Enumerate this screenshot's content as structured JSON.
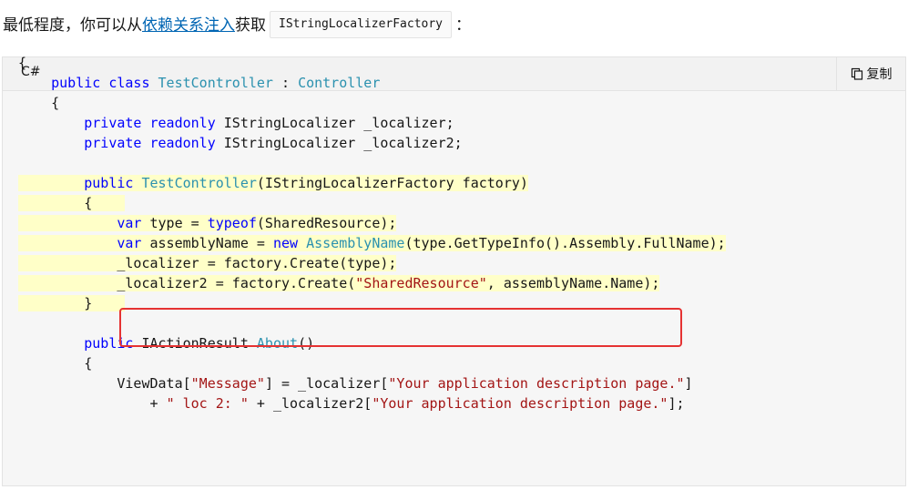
{
  "intro": {
    "before": "最低程度，你可以从",
    "link": "依赖关系注入",
    "after": "获取",
    "code": "IStringLocalizerFactory",
    "end": "："
  },
  "code_block": {
    "language": "C#",
    "copy_label": "复制",
    "copy_icon": "copy-icon",
    "highlight_color": "#ffffc8",
    "annotation_color": "#e53232",
    "lines": [
      "{",
      "    public class TestController : Controller",
      "    {",
      "        private readonly IStringLocalizer _localizer;",
      "        private readonly IStringLocalizer _localizer2;",
      "",
      "        public TestController(IStringLocalizerFactory factory)",
      "        {",
      "            var type = typeof(SharedResource);",
      "            var assemblyName = new AssemblyName(type.GetTypeInfo().Assembly.FullName);",
      "            _localizer = factory.Create(type);",
      "            _localizer2 = factory.Create(\"SharedResource\", assemblyName.Name);",
      "        }",
      "",
      "        public IActionResult About()",
      "        {",
      "            ViewData[\"Message\"] = _localizer[\"Your application description page.\"]",
      "                + \" loc 2: \" + _localizer2[\"Your application description page.\"];"
    ]
  }
}
